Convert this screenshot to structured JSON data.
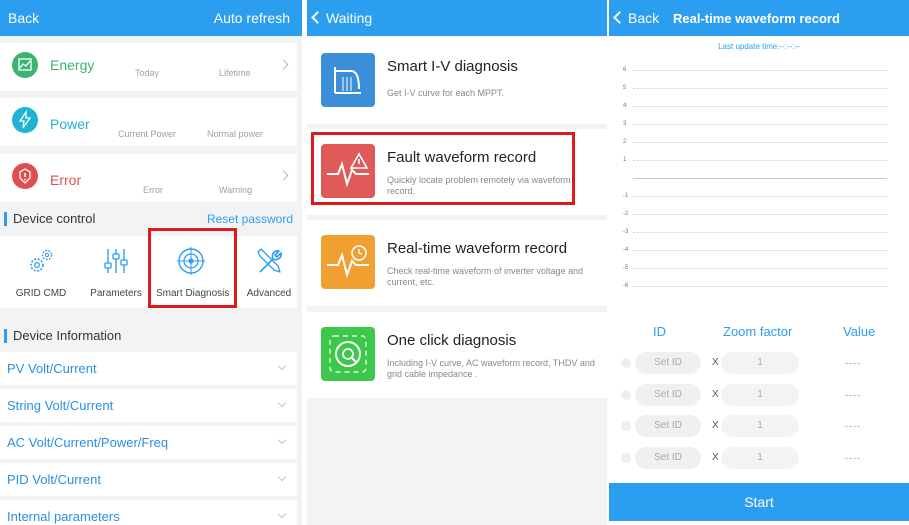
{
  "panel1": {
    "header": {
      "back": "Back",
      "auto_refresh": "Auto refresh"
    },
    "cards": [
      {
        "name": "Energy",
        "sub1": "Today",
        "sub2": "Lifetime",
        "color": "#3cb371"
      },
      {
        "name": "Power",
        "sub1": "Current Power",
        "sub2": "Normal power",
        "color": "#1fb3d6"
      },
      {
        "name": "Error",
        "sub1": "Error",
        "sub2": "Warning",
        "color": "#e04f4f"
      }
    ],
    "device_control": {
      "title": "Device control",
      "reset_password": "Reset password",
      "items": [
        {
          "label": "GRID CMD",
          "icon": "gears-icon"
        },
        {
          "label": "Parameters",
          "icon": "sliders-icon"
        },
        {
          "label": "Smart Diagnosis",
          "icon": "target-icon"
        },
        {
          "label": "Advanced",
          "icon": "wrench-screwdriver-icon"
        }
      ]
    },
    "device_information": {
      "title": "Device Information",
      "items": [
        "PV Volt/Current",
        "String Volt/Current",
        "AC Volt/Current/Power/Freq",
        "PID Volt/Current",
        "Internal parameters"
      ]
    }
  },
  "panel2": {
    "header": {
      "title": "Waiting"
    },
    "items": [
      {
        "title": "Smart I-V diagnosis",
        "desc": "Get I-V curve for each MPPT.",
        "color": "#3a8fd8",
        "icon": "iv-curve-icon"
      },
      {
        "title": "Fault waveform record",
        "desc": "Quickly locate problem remotely via waveform record.",
        "color": "#e05a5a",
        "icon": "fault-waveform-icon"
      },
      {
        "title": "Real-time waveform record",
        "desc": "Check real-time waveform of inverter voltage and current, etc.",
        "color": "#f0a030",
        "icon": "realtime-waveform-icon"
      },
      {
        "title": "One click diagnosis",
        "desc": "Including I-V curve, AC waveform record, THDV and grid cable impedance .",
        "color": "#3cc84a",
        "icon": "one-click-icon"
      }
    ]
  },
  "panel3": {
    "header": {
      "back": "Back",
      "title": "Real-time waveform record"
    },
    "last_update": "Last update time:--:--:--",
    "ticks": [
      "6",
      "5",
      "4",
      "3",
      "2",
      "1",
      "",
      "-1",
      "-2",
      "-3",
      "-4",
      "-5",
      "-6"
    ],
    "table": {
      "headers": {
        "id": "ID",
        "zoom": "Zoom factor",
        "value": "Value"
      },
      "rows": [
        {
          "set_id": "Set ID",
          "x": "X",
          "zoom": "1",
          "value": "----"
        },
        {
          "set_id": "Set ID",
          "x": "X",
          "zoom": "1",
          "value": "----"
        },
        {
          "set_id": "Set ID",
          "x": "X",
          "zoom": "1",
          "value": "----"
        },
        {
          "set_id": "Set ID",
          "x": "X",
          "zoom": "1",
          "value": "----"
        }
      ]
    },
    "start": "Start"
  },
  "colors": {
    "accent": "#2c9ef0",
    "highlight": "#e0191b"
  }
}
